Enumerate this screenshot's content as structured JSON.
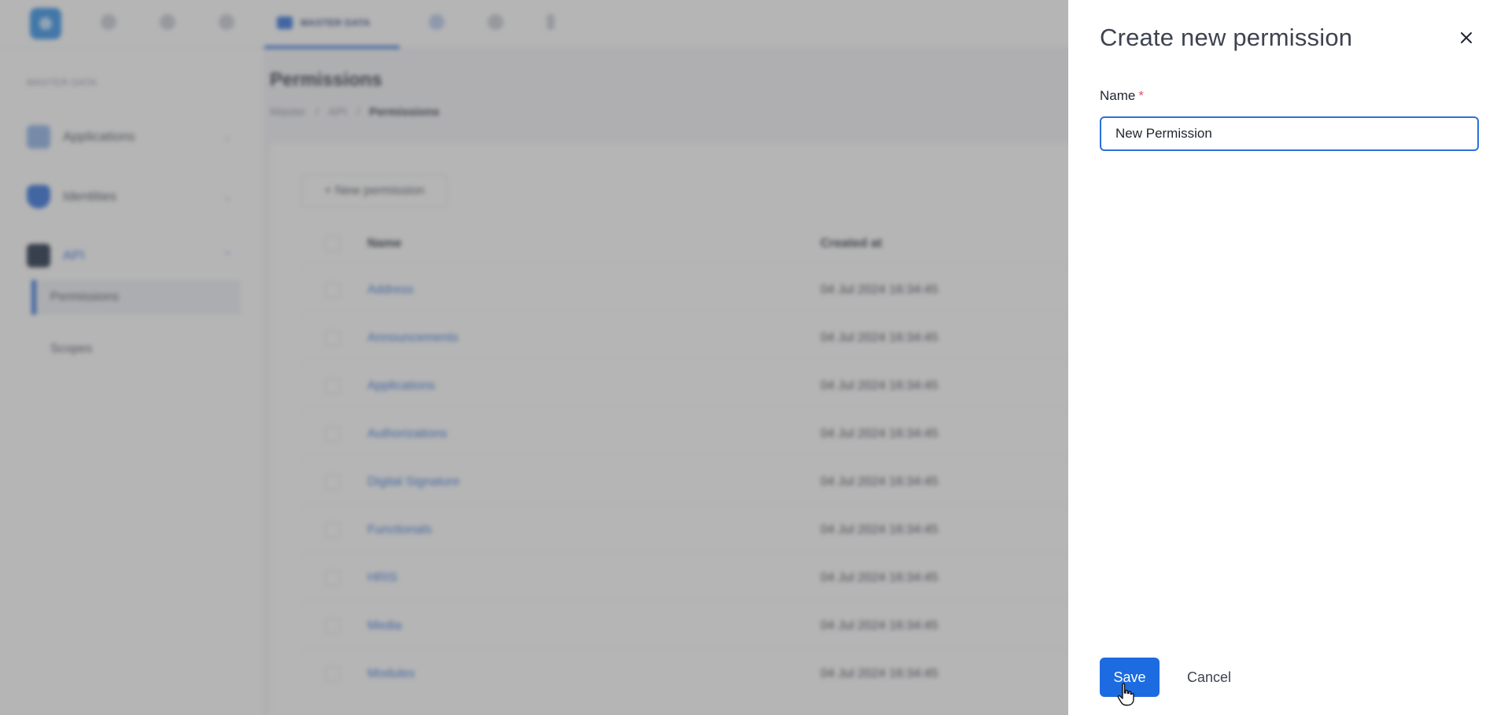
{
  "app": {
    "topbar": {
      "active_tab_label": "MASTER DATA"
    },
    "sidebar": {
      "heading": "MASTER DATA",
      "groups": [
        {
          "label": "Applications",
          "icon": "applications-icon"
        },
        {
          "label": "Identities",
          "icon": "shield-icon"
        },
        {
          "label": "API",
          "icon": "api-icon"
        }
      ],
      "sub_items": [
        {
          "label": "Permissions",
          "active": true
        },
        {
          "label": "Scopes",
          "active": false
        }
      ]
    },
    "main": {
      "title": "Permissions",
      "breadcrumbs": [
        "Master",
        "API",
        "Permissions"
      ],
      "new_button_label": "+ New permission",
      "columns": {
        "name": "Name",
        "created_at": "Created at"
      },
      "rows": [
        {
          "name": "Address",
          "created_at": "04 Jul 2024 16:34:45"
        },
        {
          "name": "Announcements",
          "created_at": "04 Jul 2024 16:34:45"
        },
        {
          "name": "Applications",
          "created_at": "04 Jul 2024 16:34:45"
        },
        {
          "name": "Authorizations",
          "created_at": "04 Jul 2024 16:34:45"
        },
        {
          "name": "Digital Signature",
          "created_at": "04 Jul 2024 16:34:45"
        },
        {
          "name": "Functionals",
          "created_at": "04 Jul 2024 16:34:45"
        },
        {
          "name": "HRIS",
          "created_at": "04 Jul 2024 16:34:45"
        },
        {
          "name": "Media",
          "created_at": "04 Jul 2024 16:34:45"
        },
        {
          "name": "Modules",
          "created_at": "04 Jul 2024 16:34:45"
        }
      ]
    }
  },
  "drawer": {
    "title": "Create new permission",
    "name_label": "Name",
    "required_mark": "*",
    "name_value": "New Permission",
    "save_label": "Save",
    "cancel_label": "Cancel"
  },
  "colors": {
    "accent": "#1d6be0",
    "required": "#e0566a",
    "overlay": "rgba(90,90,90,0.45)"
  }
}
